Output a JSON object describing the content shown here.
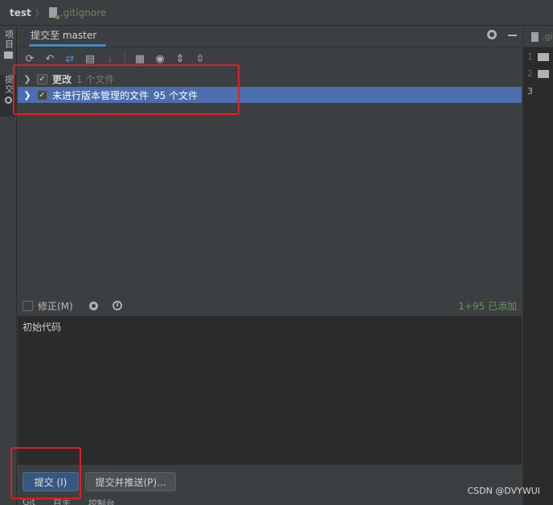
{
  "breadcrumb": {
    "project": "test",
    "separator": "〉",
    "file": ".gitignore"
  },
  "left_strip": {
    "project_tab": "项目",
    "commit_tab": "提交"
  },
  "panel": {
    "tab_label": "提交至 master",
    "settings_icon": "gear-icon",
    "hide_icon": "minus-icon"
  },
  "toolbar": {
    "icons": [
      "refresh-icon",
      "rollback-icon",
      "diff-icon",
      "shelve-icon",
      "download-icon",
      "group-icon",
      "eye-icon",
      "expand-icon",
      "collapse-icon"
    ]
  },
  "tree": {
    "changes": {
      "label": "更改",
      "count": "1 个文件"
    },
    "unversioned": {
      "label": "未进行版本管理的文件",
      "count": "95 个文件"
    }
  },
  "amend": {
    "label": "修正(M)",
    "added_status": "1+95 已添加"
  },
  "commit_message": "初始代码",
  "buttons": {
    "commit": "提交 (I)",
    "commit_push": "提交并推送(P)..."
  },
  "bottom_tabs": [
    "Git",
    "日志",
    "控制台"
  ],
  "editor": {
    "tab_name": ".gi",
    "line_numbers": [
      "1",
      "2",
      "3"
    ]
  },
  "watermark": "CSDN @DVYWUI",
  "colors": {
    "background": "#3c3f41",
    "selection": "#4b6eaf",
    "accent": "#4a88c7",
    "added_green": "#629755",
    "annotation_red": "#e01f26"
  }
}
